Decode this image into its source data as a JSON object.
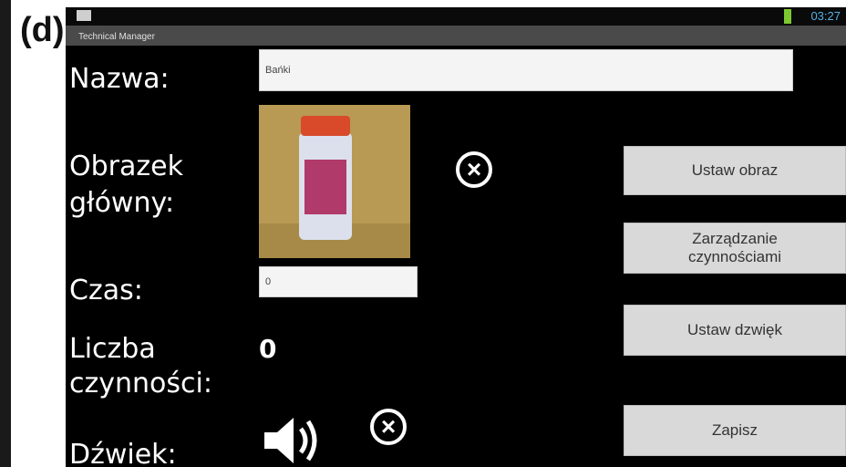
{
  "figure_label": "(d)",
  "status_bar": {
    "time": "03:27",
    "left_icon": "notification-icon",
    "battery_icon": "battery-icon",
    "battery_color": "#7dc832",
    "clock_color": "#55b0e8"
  },
  "title_bar": {
    "title": "Technical Manager"
  },
  "form": {
    "name_label": "Nazwa:",
    "name_value": "Bańki",
    "image_label_line1": "Obrazek",
    "image_label_line2": "główny:",
    "time_label": "Czas:",
    "time_value": "0",
    "count_label_line1": "Liczba",
    "count_label_line2": "czynności:",
    "count_value": "0",
    "sound_label": "Dźwiek:",
    "remove_icon": "close-circle-icon",
    "speaker_icon": "speaker-icon"
  },
  "buttons": {
    "set_image": "Ustaw obraz",
    "manage_line1": "Zarządzanie",
    "manage_line2": "czynnościami",
    "set_sound": "Ustaw dzwięk",
    "save": "Zapisz"
  },
  "colors": {
    "screen_bg": "#000000",
    "button_bg": "#d9d9d9",
    "field_bg": "#f4f4f4"
  }
}
